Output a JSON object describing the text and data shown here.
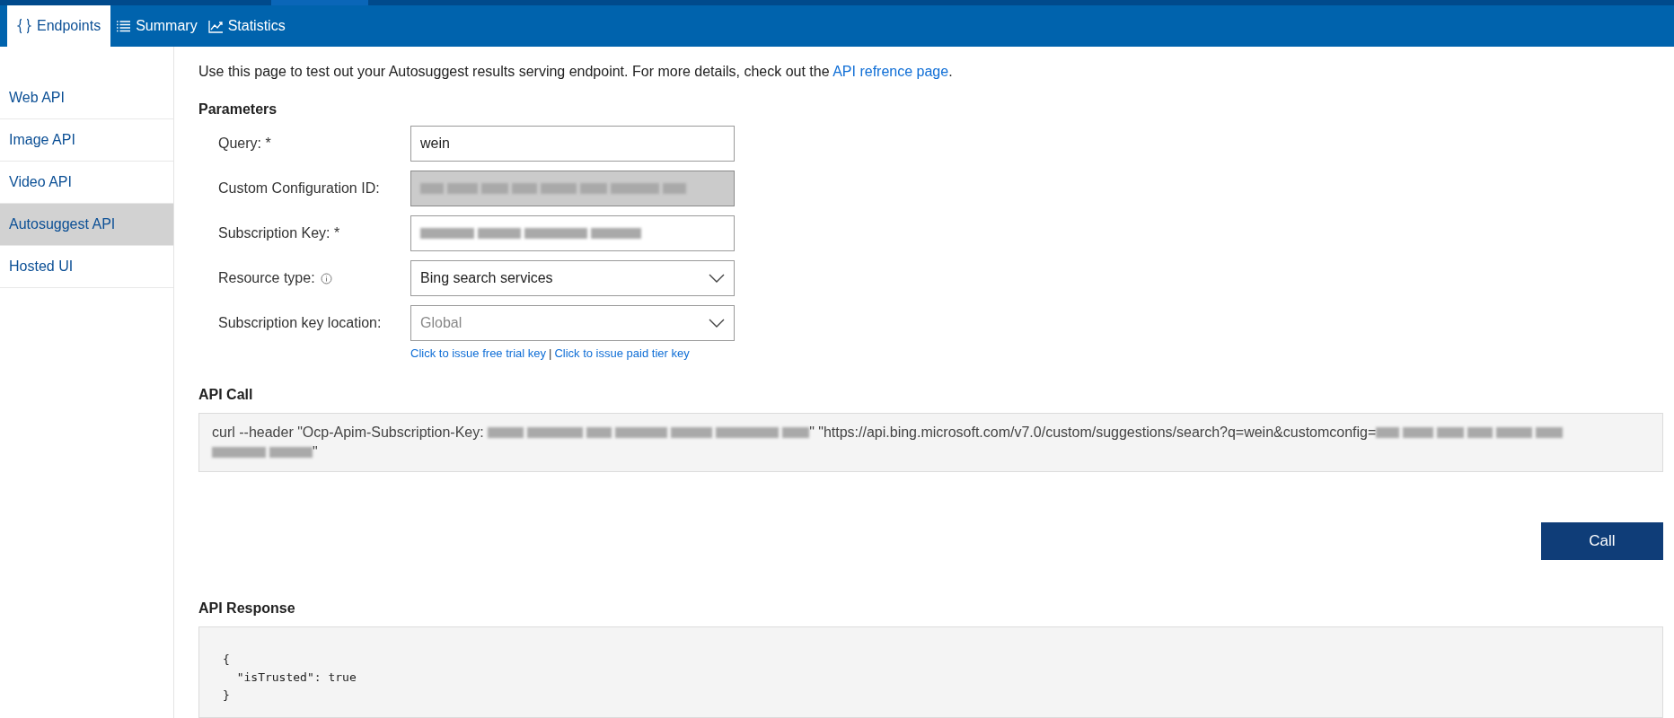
{
  "tabs": [
    {
      "label": "Endpoints",
      "selected": true
    },
    {
      "label": "Summary",
      "selected": false
    },
    {
      "label": "Statistics",
      "selected": false
    }
  ],
  "sidebar": {
    "items": [
      {
        "label": "Web API",
        "selected": false
      },
      {
        "label": "Image API",
        "selected": false
      },
      {
        "label": "Video API",
        "selected": false
      },
      {
        "label": "Autosuggest API",
        "selected": true
      },
      {
        "label": "Hosted UI",
        "selected": false
      }
    ]
  },
  "intro": {
    "text": "Use this page to test out your Autosuggest results serving endpoint. For more details, check out the ",
    "link": "API refrence page",
    "end": "."
  },
  "parameters": {
    "title": "Parameters",
    "fields": [
      {
        "kind": "text",
        "label": "Query: *",
        "value": "wein",
        "disabled": false
      },
      {
        "kind": "redacted",
        "label": "Custom Configuration ID:",
        "disabled": true
      },
      {
        "kind": "redacted",
        "label": "Subscription Key: *",
        "disabled": false
      },
      {
        "kind": "select",
        "label": "Resource type:",
        "info": true,
        "value": "Bing search services",
        "disabled": false
      },
      {
        "kind": "select",
        "label": "Subscription key location:",
        "placeholder": "Global",
        "disabled": false
      }
    ],
    "links": [
      "Click to issue free trial key",
      "Click to issue paid tier key"
    ],
    "link_separator": "|"
  },
  "api_call": {
    "title": "API Call",
    "parts": [
      {
        "kind": "text",
        "text": "curl --header \"Ocp-Apim-Subscription-Key: "
      },
      {
        "kind": "redacted"
      },
      {
        "kind": "text",
        "text": "\" \"https://api.bing.microsoft.com/v7.0/custom/suggestions/search?q=wein&customconfig="
      },
      {
        "kind": "redacted"
      },
      {
        "kind": "redacted"
      },
      {
        "kind": "text",
        "text": "\""
      }
    ]
  },
  "call_button": "Call",
  "api_response": {
    "title": "API Response",
    "lines": [
      "{",
      "  \"isTrusted\": true",
      "}"
    ]
  }
}
